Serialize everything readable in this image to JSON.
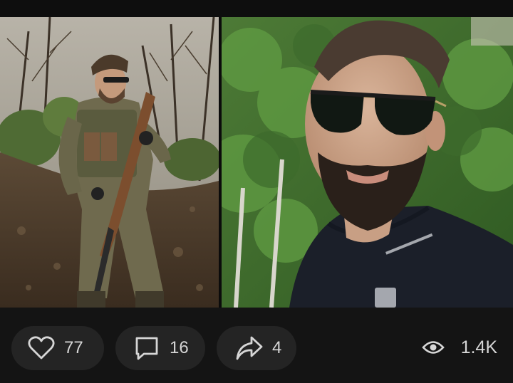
{
  "post": {
    "images": [
      {
        "description_name": "soldier-photo"
      },
      {
        "description_name": "selfie-photo"
      }
    ]
  },
  "actions": {
    "like": {
      "count": "77",
      "icon": "heart-icon"
    },
    "comment": {
      "count": "16",
      "icon": "comment-icon"
    },
    "share": {
      "count": "4",
      "icon": "share-arrow-icon"
    }
  },
  "views": {
    "count": "1.4K",
    "icon": "eye-icon"
  },
  "colors": {
    "background": "#101010",
    "pill": "#242424",
    "text": "#d6d6d6"
  }
}
